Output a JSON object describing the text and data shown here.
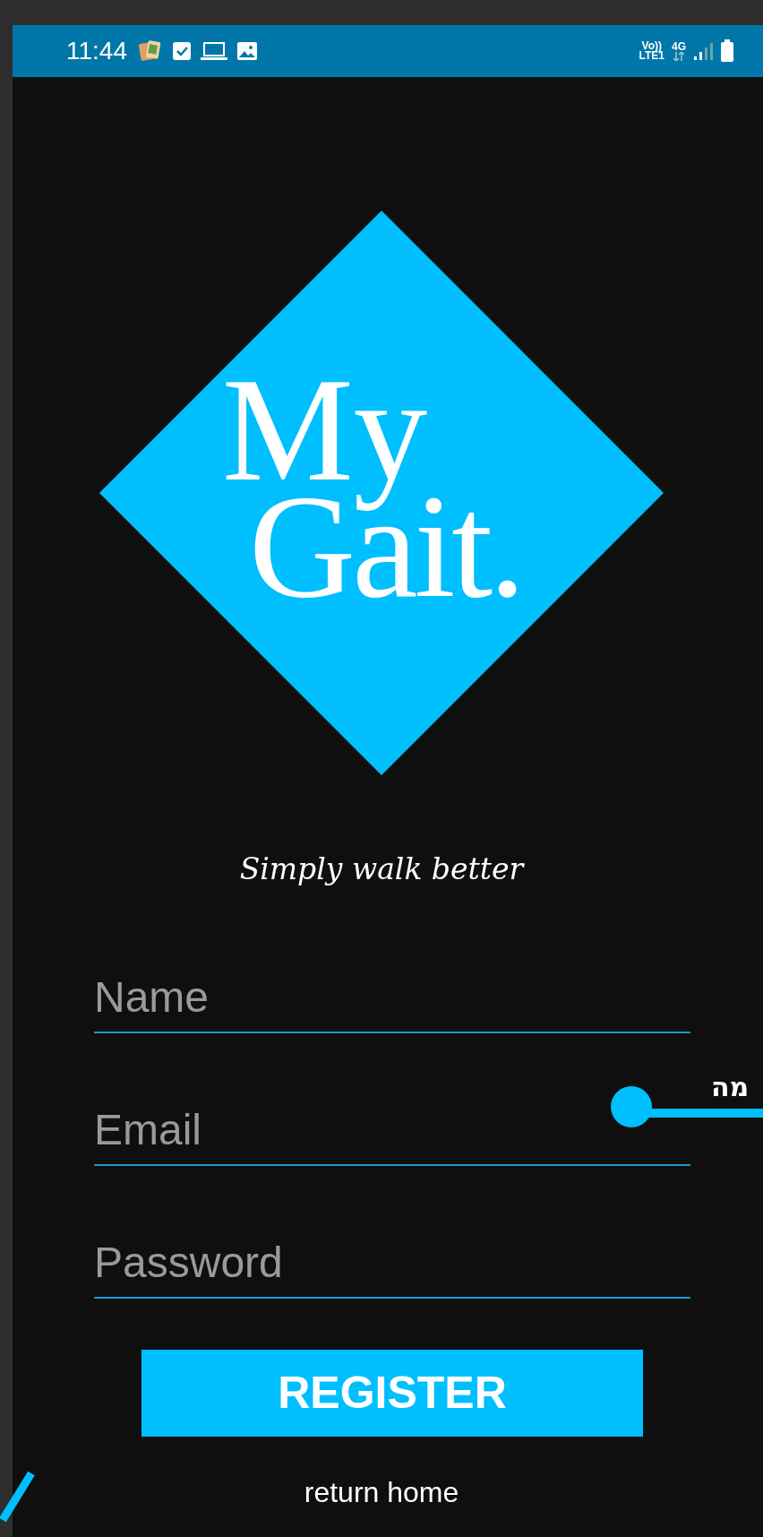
{
  "status_bar": {
    "time": "11:44",
    "volte": "Vo))",
    "lte": "LTE1",
    "network": "4G"
  },
  "logo": {
    "line_1": "My",
    "line_2": "Gait."
  },
  "tagline": "Simply walk better",
  "fields": [
    {
      "placeholder": "Name"
    },
    {
      "placeholder": "Email"
    },
    {
      "placeholder": "Password"
    }
  ],
  "register_button": "REGISTER",
  "return_link": "return home",
  "annotation": {
    "text": "מה"
  }
}
